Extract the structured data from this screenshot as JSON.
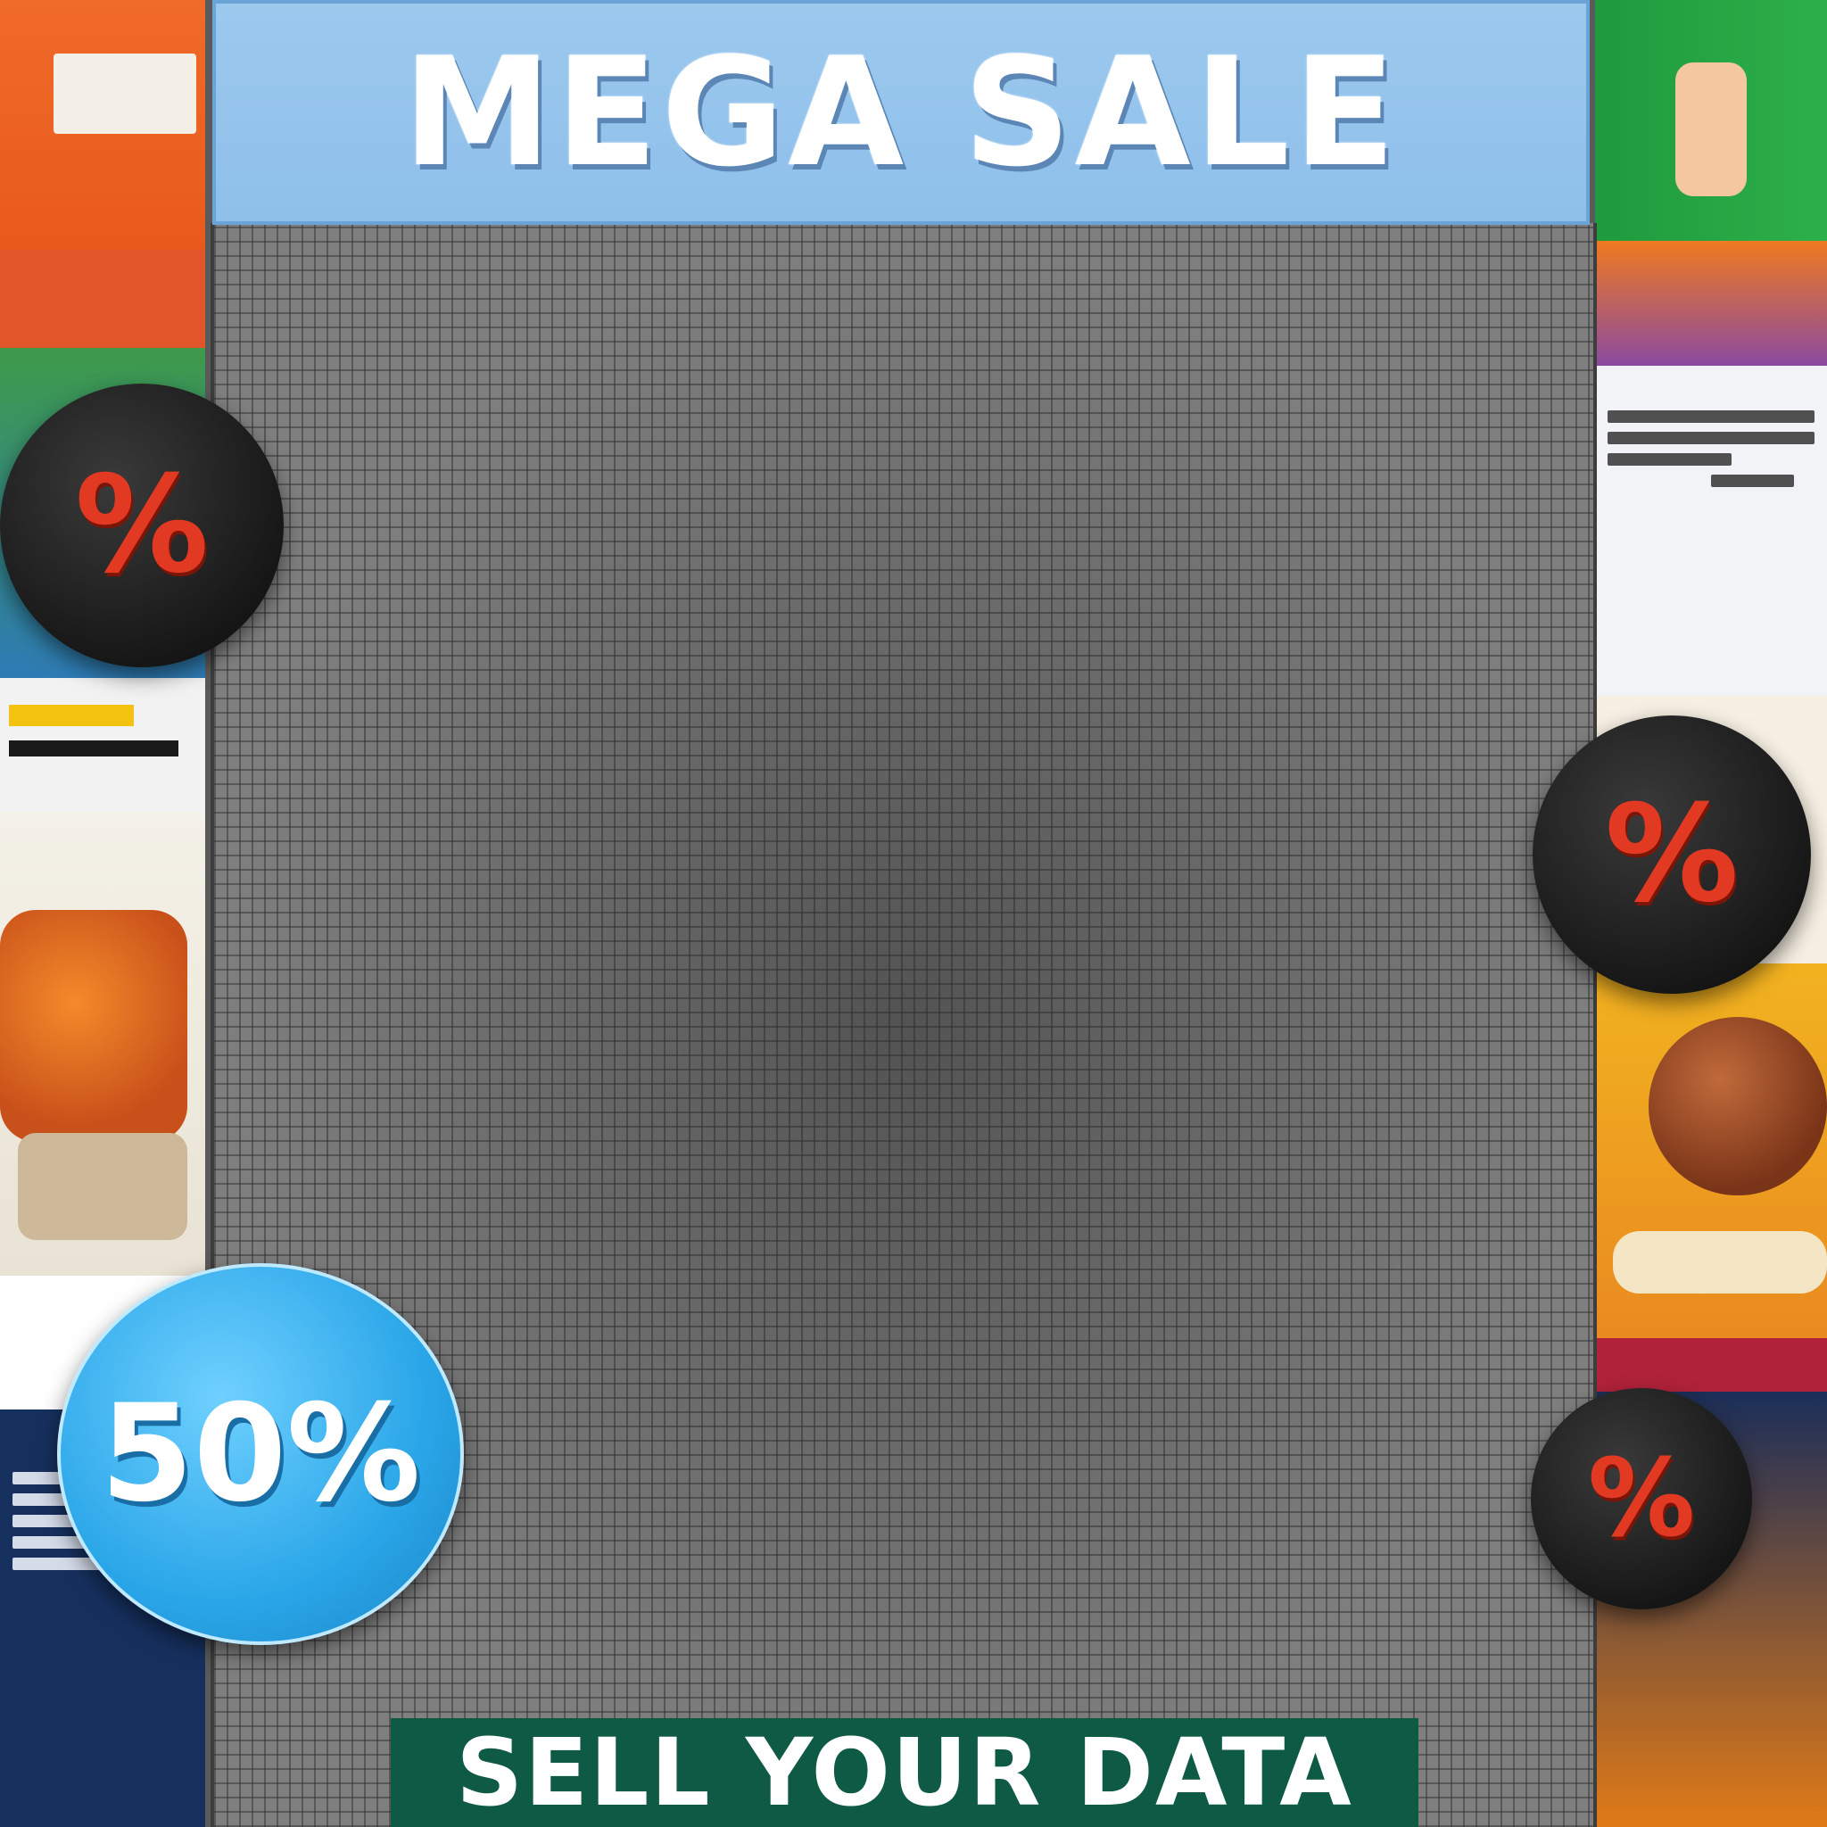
{
  "header": {
    "title": "MEGA SALE"
  },
  "footer": {
    "label": "SELL YOUR DATA"
  },
  "badges": {
    "discount_large": "50%",
    "percent_symbol": "%"
  },
  "colors": {
    "header_bg": "#9cc8ee",
    "footer_bg": "#0f5a44",
    "badge_dark": "#151515",
    "badge_percent": "#e23a22",
    "badge_blue": "#2aa6e8"
  }
}
